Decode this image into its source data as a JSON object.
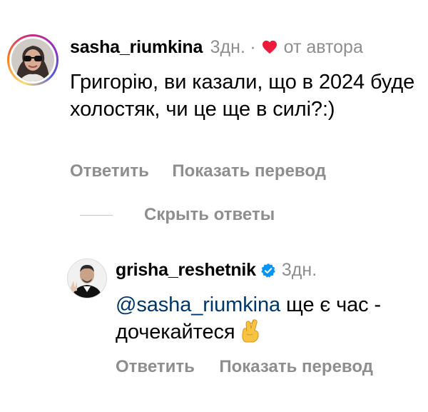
{
  "comment": {
    "username": "sasha_riumkina",
    "time": "3дн.",
    "separator": "·",
    "liked_by_author": "от автора",
    "text": "Григорію, ви казали, що в 2024 буде холостяк, чи це ще в силі?:)",
    "reply_label": "Ответить",
    "translate_label": "Показать перевод"
  },
  "replies_toggle": {
    "label": "Скрыть ответы"
  },
  "reply": {
    "username": "grisha_reshetnik",
    "time": "3дн.",
    "mention": "@sasha_riumkina",
    "text": " ще є час - дочекайтеся",
    "reply_label": "Ответить",
    "translate_label": "Показать перевод"
  },
  "icons": {
    "heart": "heart-icon",
    "verified": "verified-badge-icon",
    "emoji": "crossed-fingers-emoji"
  },
  "colors": {
    "heart": "#ed1c3d",
    "verified": "#0095f6",
    "meta_text": "#8e8e8e",
    "mention": "#00376b"
  }
}
